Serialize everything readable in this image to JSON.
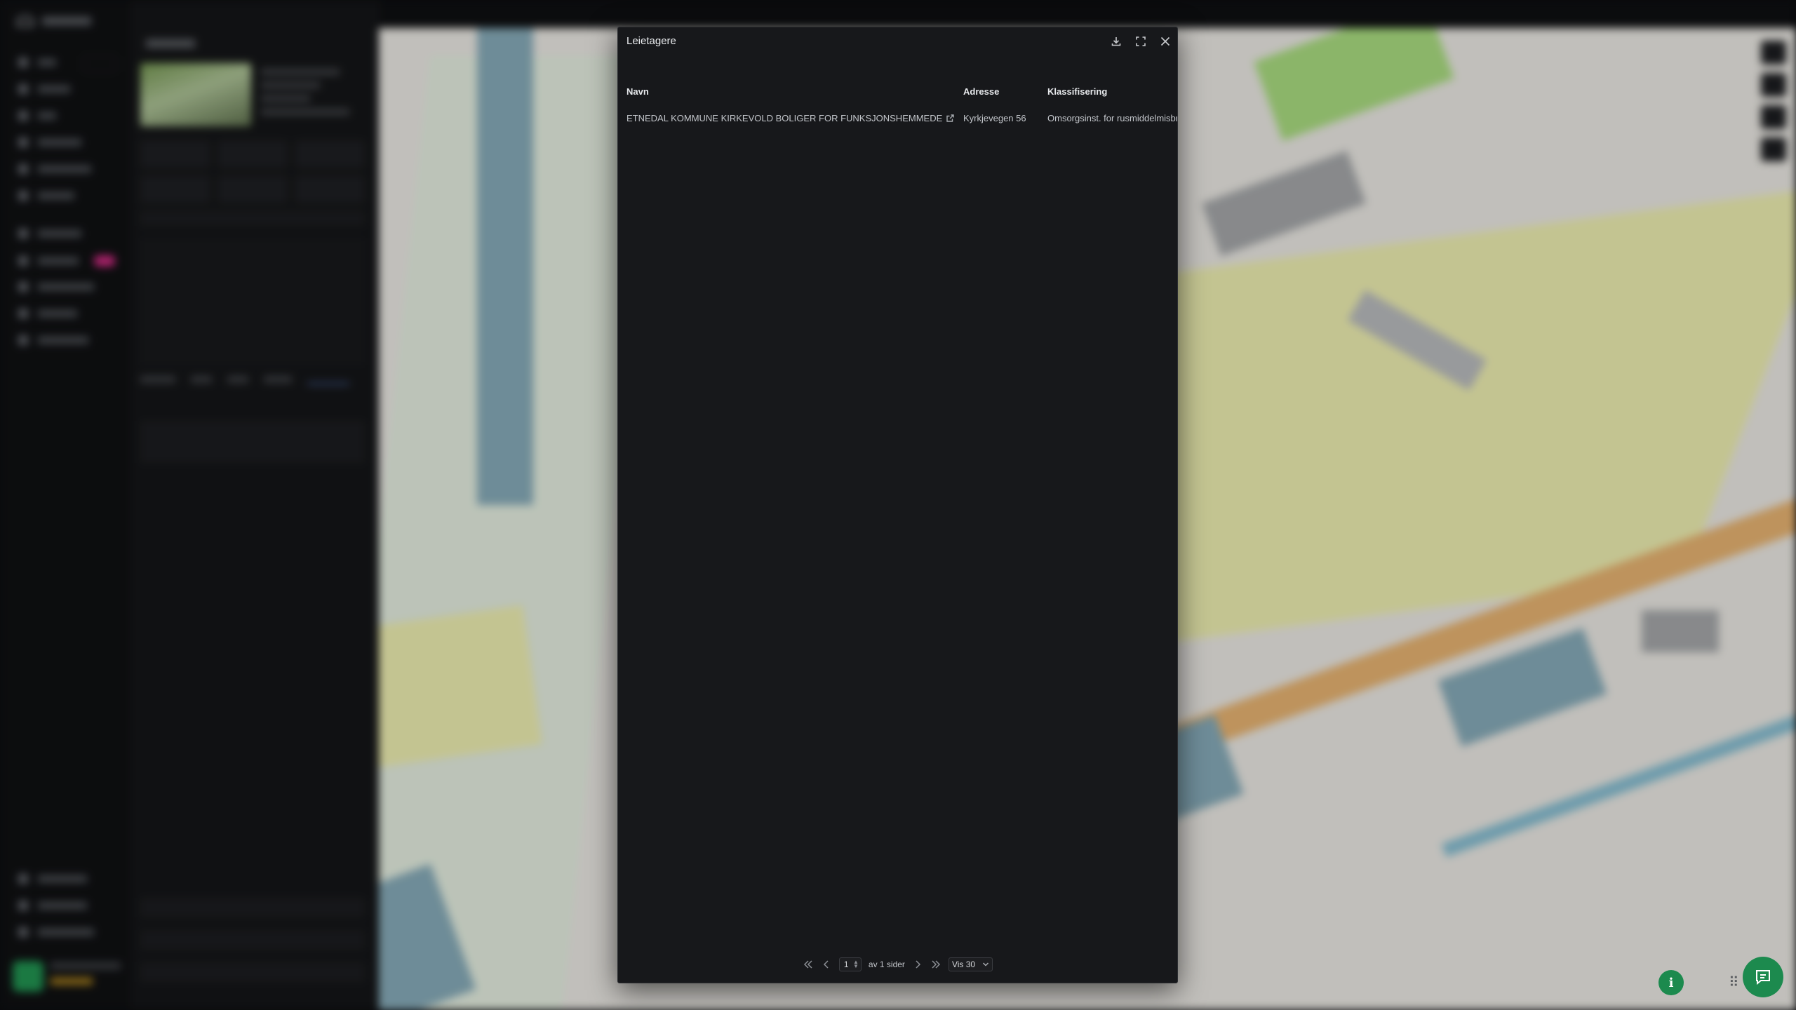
{
  "modal": {
    "title": "Leietagere",
    "columns": [
      "Navn",
      "Adresse",
      "Klassifisering"
    ],
    "rows": [
      {
        "navn": "ETNEDAL KOMMUNE KIRKEVOLD BOLIGER FOR FUNKSJONSHEMMEDE",
        "adresse": "Kyrkjevegen 56",
        "klassifisering": "Omsorgsinst. for rusmiddelmisbruker"
      }
    ],
    "pagination": {
      "current_page": "1",
      "of_pages_label": "av 1 sider",
      "per_page_label": "Vis 30"
    },
    "icons": {
      "download": "download-icon",
      "expand": "expand-icon",
      "close": "close-icon"
    }
  },
  "colors": {
    "modal_bg": "#17181b",
    "accent_green": "#1c8a4e",
    "new_badge": "#c2277a"
  }
}
